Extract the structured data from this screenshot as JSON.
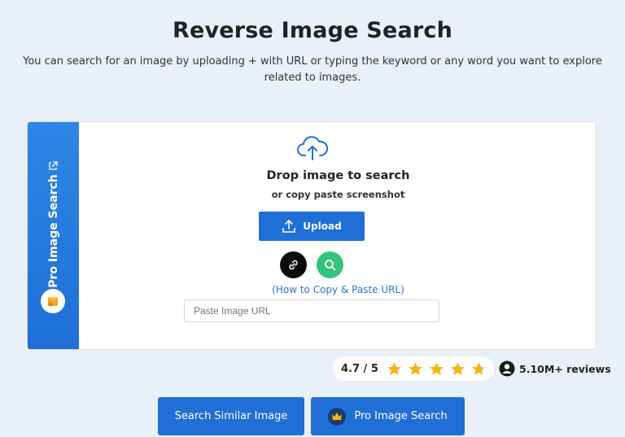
{
  "page": {
    "title": "Reverse Image Search",
    "subtitle": "You can search for an image by uploading + with URL or typing the keyword or any word you want to explore related to images."
  },
  "side_tab": {
    "label": "Pro Image Search",
    "icons": [
      "external-link-icon",
      "badge-icon"
    ]
  },
  "upload_area": {
    "cloud_icon": "cloud-upload-icon",
    "drop_title": "Drop image to search",
    "drop_sub": "or copy paste screenshot",
    "upload_label": "Upload",
    "link_icon": "link-icon",
    "search_icon": "search-icon",
    "howto_link": "(How to Copy & Paste URL)",
    "url_placeholder": "Paste Image URL"
  },
  "rating": {
    "text": "4.7 / 5",
    "value": 4.7,
    "max": 5,
    "reviews": "5.10M+ reviews"
  },
  "buttons": {
    "similar": "Search Similar Image",
    "pro": "Pro Image Search"
  },
  "colors": {
    "accent": "#1f6fd6",
    "background": "#e9f0f8",
    "star": "#f5b50a",
    "search_green": "#33c37a",
    "link_text": "#2f73c9"
  }
}
